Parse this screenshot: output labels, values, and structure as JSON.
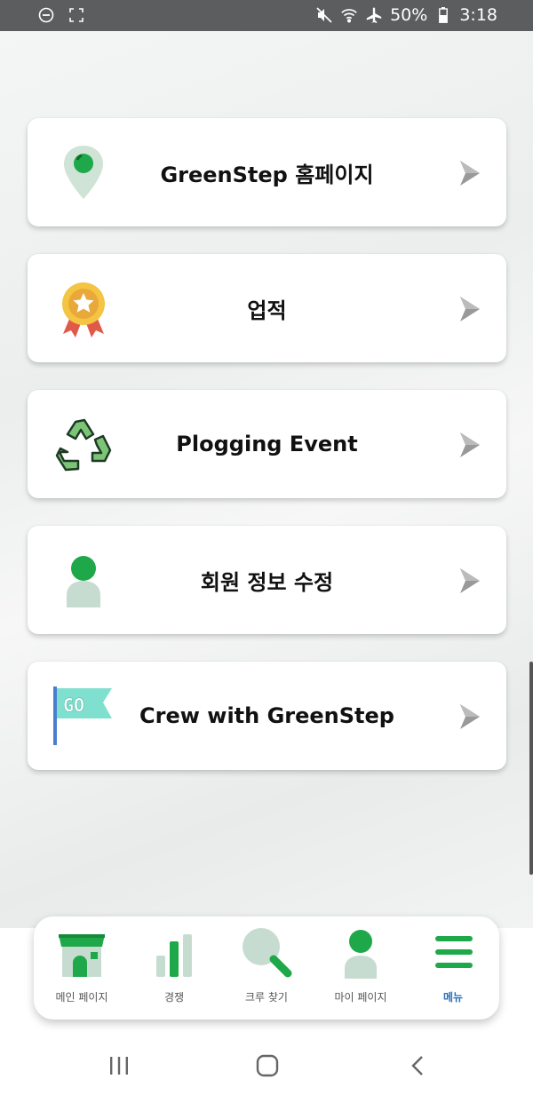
{
  "status_bar": {
    "battery": "50%",
    "time": "3:18"
  },
  "menu": {
    "items": [
      {
        "label": "GreenStep 홈페이지",
        "icon": "map-pin-icon"
      },
      {
        "label": "업적",
        "icon": "award-medal-icon"
      },
      {
        "label": "Plogging Event",
        "icon": "recycle-icon"
      },
      {
        "label": "회원 정보 수정",
        "icon": "user-profile-icon"
      },
      {
        "label": "Crew with GreenStep",
        "icon": "go-flag-icon"
      }
    ],
    "chevron_icon": "chevron-right-icon"
  },
  "bottom_nav": {
    "items": [
      {
        "label": "메인 페이지",
        "icon": "store-icon"
      },
      {
        "label": "경쟁",
        "icon": "bar-chart-icon"
      },
      {
        "label": "크루 찾기",
        "icon": "search-icon"
      },
      {
        "label": "마이 페이지",
        "icon": "user-icon"
      },
      {
        "label": "메뉴",
        "icon": "hamburger-menu-icon",
        "active": true
      }
    ]
  },
  "colors": {
    "accent_green": "#1fa84a",
    "active_nav": "#2a6fb8",
    "status_bar": "#5b5d5f"
  }
}
